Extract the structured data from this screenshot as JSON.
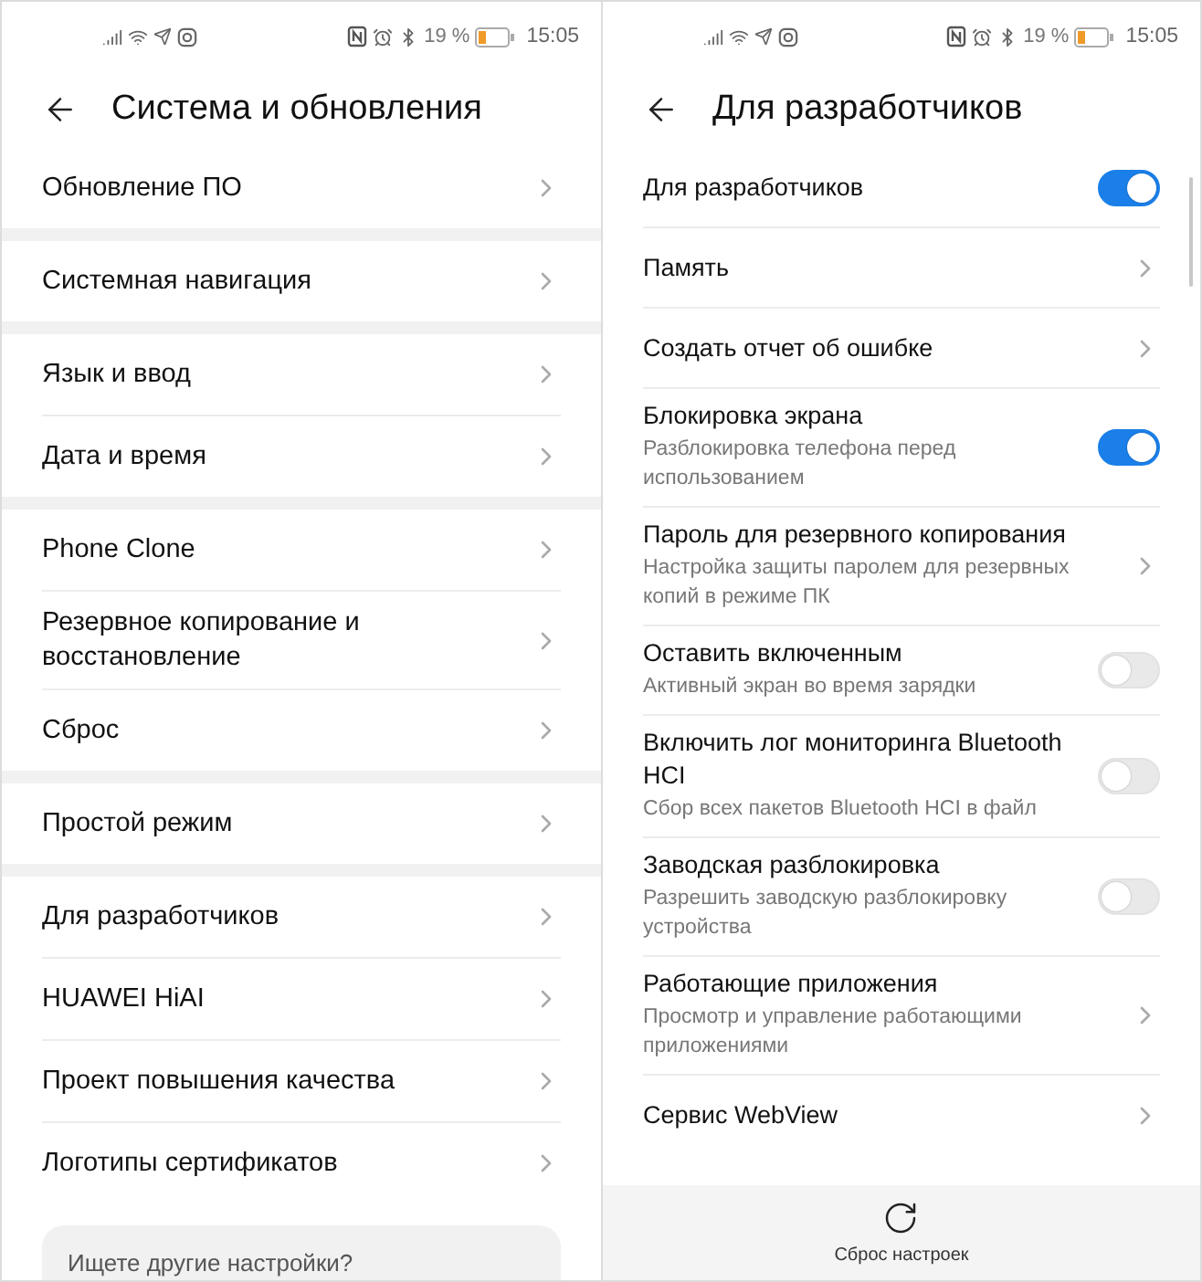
{
  "screens": [
    {
      "status_bar": {
        "battery": "19 %",
        "time": "15:05"
      },
      "title": "Система и обновления",
      "groups": [
        [
          {
            "label": "Обновление ПО"
          }
        ],
        [
          {
            "label": "Системная навигация"
          }
        ],
        [
          {
            "label": "Язык и ввод"
          },
          {
            "label": "Дата и время"
          }
        ],
        [
          {
            "label": "Phone Clone"
          },
          {
            "label": "Резервное копирование и восстановление"
          },
          {
            "label": "Сброс"
          }
        ],
        [
          {
            "label": "Простой режим"
          }
        ],
        [
          {
            "label": "Для разработчиков"
          },
          {
            "label": "HUAWEI HiAI"
          },
          {
            "label": "Проект повышения качества"
          },
          {
            "label": "Логотипы сертификатов"
          }
        ]
      ],
      "search_card": {
        "text": "Ищете другие настройки?"
      }
    },
    {
      "status_bar": {
        "battery": "19 %",
        "time": "15:05"
      },
      "title": "Для разработчиков",
      "items": [
        {
          "kind": "toggle",
          "title": "Для разработчиков",
          "on": true
        },
        {
          "kind": "link",
          "title": "Память"
        },
        {
          "kind": "link",
          "title": "Создать отчет об ошибке"
        },
        {
          "kind": "toggle",
          "title": "Блокировка экрана",
          "subtitle": "Разблокировка телефона перед использованием",
          "on": true
        },
        {
          "kind": "link",
          "title": "Пароль для резервного копирования",
          "subtitle": "Настройка защиты паролем для резервных копий в режиме ПК"
        },
        {
          "kind": "toggle",
          "title": "Оставить включенным",
          "subtitle": "Активный экран во время зарядки",
          "on": false
        },
        {
          "kind": "toggle",
          "title": "Включить лог мониторинга Bluetooth HCI",
          "subtitle": "Сбор всех пакетов Bluetooth HCI в файл",
          "on": false
        },
        {
          "kind": "toggle",
          "title": "Заводская разблокировка",
          "subtitle": "Разрешить заводскую разблокировку устройства",
          "on": false
        },
        {
          "kind": "link",
          "title": "Работающие приложения",
          "subtitle": "Просмотр и управление работающими приложениями"
        },
        {
          "kind": "link",
          "title": "Сервис WebView"
        }
      ],
      "bottom_bar": {
        "label": "Сброс настроек"
      }
    }
  ]
}
